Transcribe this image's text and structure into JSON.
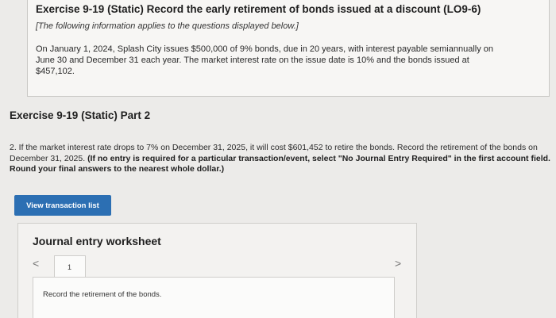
{
  "exercise": {
    "title": "Exercise 9-19 (Static) Record the early retirement of bonds issued at a discount (LO9-6)",
    "note": "[The following information applies to the questions displayed below.]",
    "text": "On January 1, 2024, Splash City issues $500,000 of 9% bonds, due in 20 years, with interest payable semiannually on June 30 and December 31 each year. The market interest rate on the issue date is 10% and the bonds issued at $457,102."
  },
  "part": {
    "title": "Exercise 9-19 (Static) Part 2",
    "question": "2. If the market interest rate drops to 7% on December 31, 2025, it will cost $601,452 to retire the bonds. Record the retirement of the bonds on December 31, 2025. ",
    "instruction": "(If no entry is required for a particular transaction/event, select \"No Journal Entry Required\" in the first account field. Round your final answers to the nearest whole dollar.)"
  },
  "buttons": {
    "view_transaction_list": "View transaction list"
  },
  "worksheet": {
    "title": "Journal entry worksheet",
    "prev_glyph": "<",
    "next_glyph": ">",
    "tab_number": "1",
    "instruction": "Record the retirement of the bonds."
  }
}
